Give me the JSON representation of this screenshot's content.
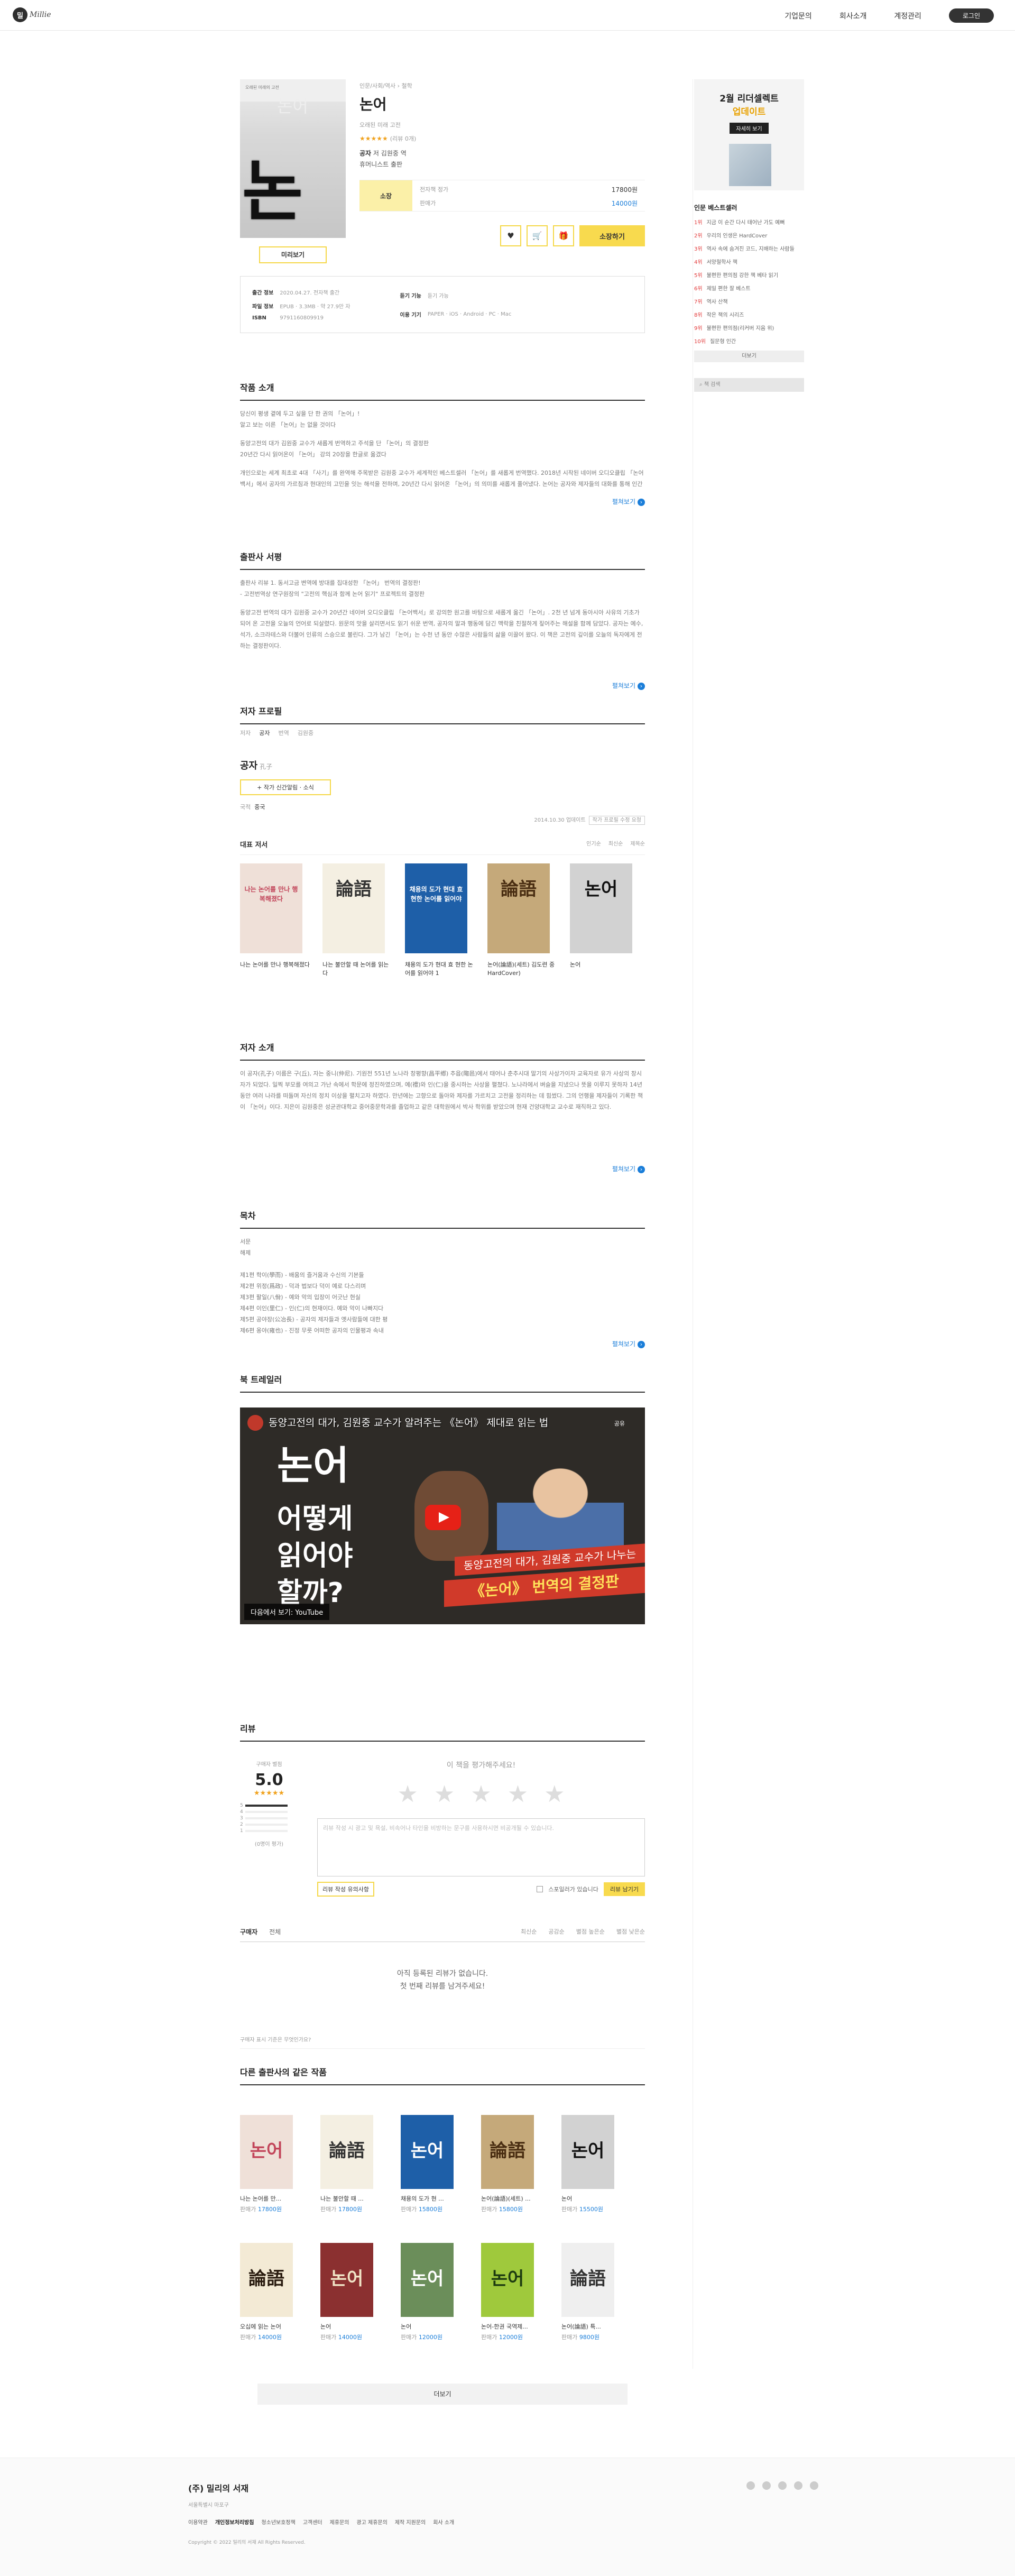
{
  "header": {
    "logo_mark": "밀",
    "logo_text": "Millie",
    "nav": [
      "기업문의",
      "회사소개",
      "계정관리"
    ],
    "login": "로그인"
  },
  "book": {
    "crumb": "인문/사회/역사 › 철학",
    "title": "논어",
    "subtitle": "오래된 미래 고전",
    "stars": "★★★★★",
    "rating_count": "(리뷰 0개)",
    "author_label": "공자",
    "author_line": "저  김원중 역",
    "publisher": "휴머니스트 출판",
    "cover_small": "오래된 미래의 고전",
    "cover_title": "논어",
    "cover_big": "논어",
    "preview": "미리보기",
    "price": {
      "label": "소장",
      "rows": [
        {
          "k": "전자책 정가",
          "v": "17800원"
        },
        {
          "k": "판매가",
          "v": "14000원"
        }
      ]
    },
    "actions": {
      "like": "♥",
      "cart": "🛒",
      "gift": "🎁",
      "buy": "소장하기"
    },
    "meta": {
      "left": [
        {
          "k": "출간 정보",
          "v": "2020.04.27. 전자책 출간"
        },
        {
          "k": "파일 정보",
          "v": "EPUB · 3.3MB · 약 27.9만 자"
        },
        {
          "k": "ISBN",
          "v": "9791160809919"
        }
      ],
      "right": [
        {
          "k": "듣기 기능",
          "v": "듣기 가능"
        },
        {
          "k": "이용 기기",
          "v": "PAPER · iOS · Android · PC · Mac"
        }
      ]
    }
  },
  "intro": {
    "title": "작품 소개",
    "paras": [
      "당신이 평생 곁에 두고 싶을 단 한 권의 「논어」!\n알고 보는 이른 「논어」는 없을 것이다",
      "동양고전의 대가 김원중 교수가 새롭게 번역하고 주석을 단 「논어」의 결정판\n20년간 다시 읽어온이 「논어」 강의 20장을 한글로 옮겼다",
      "개인으로는 세계 최초로 4대 「사기」를 완역해 주목받은 김원중 교수가 세계적인 베스트셀러 「논어」를 새롭게 번역했다. 2018년 시작된 네이버 오디오클립 「논어백서」에서 공자의 가르침과 현대인의 고민을 잇는 해석을 전하며, 20년간 다시 읽어온 「논어」의 의미를 새롭게 풀어냈다. 논어는 공자와 제자들의 대화를 통해 인간이 어떻게 살아야 하는지 탐색하는 책이다."
    ],
    "more": "펼쳐보기"
  },
  "pubreview": {
    "title": "출판사 서평",
    "paras": [
      "출판사 리뷰 1. 동서고금 변역에 방대를 집대성한 「논어」 번역의 결정판!\n- 고전번역상 연구원장의 \"고전의 핵심과 함께 논어 읽기\" 프로젝트의 결정판",
      "동양고전 번역의 대가 김원중 교수가 20년간 네이버 오디오클립 「논어백서」로 강의한 원고를 바탕으로 새롭게 옮긴 「논어」. 2천 년 넘게 동아시아 사유의 기초가 되어 온 고전을 오늘의 언어로 되살렸다. 원문의 맛을 살리면서도 읽기 쉬운 번역, 공자의 말과 행동에 담긴 맥락을 친절하게 짚어주는 해설을 함께 담았다. 공자는 예수, 석가, 소크라테스와 더불어 인류의 스승으로 불린다. 그가 남긴 「논어」는 수천 년 동안 수많은 사람들의 삶을 이끌어 왔다. 이 책은 고전의 깊이를 오늘의 독자에게 전하는 결정판이다."
    ],
    "more": "펼쳐보기"
  },
  "profile": {
    "title": "저자 프로필",
    "tabs": [
      "저자",
      "공자",
      "번역",
      "김원중"
    ],
    "name": "공자",
    "name_hanja": "孔子",
    "fav": "+ 작가 신간알림 · 소식",
    "kind_k": "국적",
    "kind_v": "중국",
    "upd": "2014.10.30 업데이트",
    "upd_btn": "작가 프로필 수정 요청"
  },
  "rep": {
    "title": "대표 저서",
    "tags": [
      "인기순",
      "최신순",
      "제목순"
    ],
    "books": [
      {
        "name": "나는 논어를 만나 행복해졌다",
        "bg": "#efe0d8",
        "fg": "#c2455a",
        "label": "나는 논어를 만나 행복해졌다"
      },
      {
        "name": "나는 불안할 때 논어를 읽는다",
        "bg": "#f4efe2",
        "fg": "#333",
        "label": "論語"
      },
      {
        "name": "채용의 도가 현대 효 현한 논어를 읽어야 1",
        "bg": "#1e5fa8",
        "fg": "#fff",
        "label": "채용의 도가 현대 효 현한 논어를 읽어야"
      },
      {
        "name": "논어(論語)(세트) 김도련 중 HardCover)",
        "bg": "#c5a97a",
        "fg": "#4a2e12",
        "label": "論語"
      },
      {
        "name": "논어",
        "bg": "#d2d2d2",
        "fg": "#111",
        "label": "논어"
      }
    ]
  },
  "authorIntro": {
    "title": "저자 소개",
    "paras": [
      "이 공자(孔子) 이름은 구(丘), 자는 중니(仲尼). 기원전 551년 노나라 창평향(昌平鄕) 추읍(陬邑)에서 태어나 춘추시대 말기의 사상가이자 교육자로 유가 사상의 창시자가 되었다. 일찍 부모를 여의고 가난 속에서 학문에 정진하였으며, 예(禮)와 인(仁)을 중시하는 사상을 펼쳤다. 노나라에서 벼슬을 지냈으나 뜻을 이루지 못하자 14년 동안 여러 나라를 떠돌며 자신의 정치 이상을 펼치고자 하였다. 만년에는 고향으로 돌아와 제자를 가르치고 고전을 정리하는 데 힘썼다. 그의 언행을 제자들이 기록한 책이 「논어」이다. 지은이 김원중은 성균관대학교 중어중문학과를 졸업하고 같은 대학원에서 박사 학위를 받았으며 현재 건양대학교 교수로 재직하고 있다."
    ],
    "more": "펼쳐보기"
  },
  "toc": {
    "title": "목차",
    "lines": [
      "서문",
      "해제",
      "",
      "제1편 학이(學而) - 배움의 즐거움과 수신의 기본들",
      "제2편 위정(爲政) - 덕과 법보다 덕이 예로 다스리며",
      "제3편 팔일(八佾) - 예와 악의 입장이 어긋난 현실",
      "제4편 이인(里仁) - 인(仁)의 현재이다. 예와 악이 나빠지다",
      "제5편 공야장(公冶長) - 공자의 제자들과 옛사람들에 대한 평",
      "제6편 옹야(雍也) - 진정 무릇 어떠한 공자의 인물평과 속내"
    ],
    "more": "펼쳐보기"
  },
  "trailer": {
    "title": "북 트레일러",
    "vtitle": "동양고전의 대가, 김원중 교수가 알려주는 《논어》 제대로 읽는 법",
    "share": "공유",
    "big": "논어",
    "sub1": "어떻게",
    "sub2": "읽어야",
    "sub3": "할까?",
    "red": "동양고전의 대가, 김원중 교수가 나누는",
    "yel": "《논어》 번역의 결정판",
    "yt": "다음에서 보기: YouTube"
  },
  "review": {
    "title": "리뷰",
    "avg_label": "구매자 별점",
    "avg": "5.0",
    "stars": "★★★★★",
    "bars": [
      {
        "n": "5",
        "fill": 1
      },
      {
        "n": "4",
        "fill": 0
      },
      {
        "n": "3",
        "fill": 0
      },
      {
        "n": "2",
        "fill": 0
      },
      {
        "n": "1",
        "fill": 0
      }
    ],
    "count_label": "(0명이 평가)",
    "q": "이 책을 평가해주세요!",
    "star_glyph": "★",
    "placeholder": "리뷰 작성 시 광고 및 욕설, 비속어나 타인을 비방하는 문구를 사용하시면 비공개될 수 있습니다.",
    "guide": "리뷰 작성 유의사항",
    "spoiler": "스포일러가 있습니다",
    "submit": "리뷰 남기기",
    "tabs": [
      "구매자",
      "전체"
    ],
    "sorts": [
      "최신순",
      "공감순",
      "별점 높은순",
      "별점 낮은순"
    ],
    "empty1": "아직 등록된 리뷰가 없습니다.",
    "empty2": "첫 번째 리뷰를 남겨주세요!",
    "note": "구매자 표시 기준은 무엇인가요?"
  },
  "others": {
    "title": "다른 출판사의 같은 작품",
    "price_label": "판매가",
    "row1": [
      {
        "name": "나는 논어를 만...",
        "price": "17800원",
        "bg": "#efe0d8",
        "fg": "#c2455a",
        "label": "논어"
      },
      {
        "name": "나는 불안할 때 ...",
        "price": "17800원",
        "bg": "#f4efe2",
        "fg": "#333",
        "label": "論語"
      },
      {
        "name": "채용의 도가 현 ...",
        "price": "15800원",
        "bg": "#1e5fa8",
        "fg": "#fff",
        "label": "논어"
      },
      {
        "name": "논어(論語)(세트) ...",
        "price": "15800원",
        "bg": "#c5a97a",
        "fg": "#4a2e12",
        "label": "論語"
      },
      {
        "name": "논어",
        "price": "15500원",
        "bg": "#d2d2d2",
        "fg": "#111",
        "label": "논어"
      }
    ],
    "row2": [
      {
        "name": "오십에 읽는 논어",
        "price": "14000원",
        "bg": "#f3ead5",
        "fg": "#2a1c10",
        "label": "論語"
      },
      {
        "name": "논어",
        "price": "14000원",
        "bg": "#8b3030",
        "fg": "#f1e5c7",
        "label": "논어"
      },
      {
        "name": "논어",
        "price": "12000원",
        "bg": "#6b8e5a",
        "fg": "#fff",
        "label": "논어"
      },
      {
        "name": "논어-한권 국역제...",
        "price": "12000원",
        "bg": "#9fc93c",
        "fg": "#1d3b10",
        "label": "논어"
      },
      {
        "name": "논어(論語) 특...",
        "price": "9800원",
        "bg": "#efefef",
        "fg": "#333",
        "label": "論語"
      }
    ],
    "more": "더보기"
  },
  "sidebar": {
    "ad1": "2월 리더셀렉트",
    "ad2": "업데이트",
    "ad3": "자세히 보기",
    "best_title": "인문 베스트셀러",
    "best": [
      {
        "r": "1위",
        "t": "지금 이 순간 다시 태어난 가도 예뻐"
      },
      {
        "r": "2위",
        "t": "우리의 인생은 HardCover"
      },
      {
        "r": "3위",
        "t": "역사 속에 숨겨진 코드, 지배하는 사람들"
      },
      {
        "r": "4위",
        "t": "서양철학사 책"
      },
      {
        "r": "5위",
        "t": "불편한 편의점 강한 책 베타 읽기"
      },
      {
        "r": "6위",
        "t": "제일 편한 잘 베스트"
      },
      {
        "r": "7위",
        "t": "역사 산책"
      },
      {
        "r": "8위",
        "t": "작은 책의 시리즈"
      },
      {
        "r": "9위",
        "t": "불편한 편의점(리커버 지음 위)"
      },
      {
        "r": "10위",
        "t": "질문형 인간"
      }
    ],
    "best_more": "더보기",
    "search": "책 검색"
  },
  "footer": {
    "name": "(주) 밀리의 서재",
    "sub": "서울특별시 마포구",
    "links": [
      "이용약관",
      "개인정보처리방침",
      "청소년보호정책",
      "고객센터",
      "제휴문의",
      "광고 제휴문의",
      "제작 지원문의",
      "회사 소개"
    ],
    "copy": "Copyright © 2022 밀리의 서재 All Rights Reserved."
  }
}
